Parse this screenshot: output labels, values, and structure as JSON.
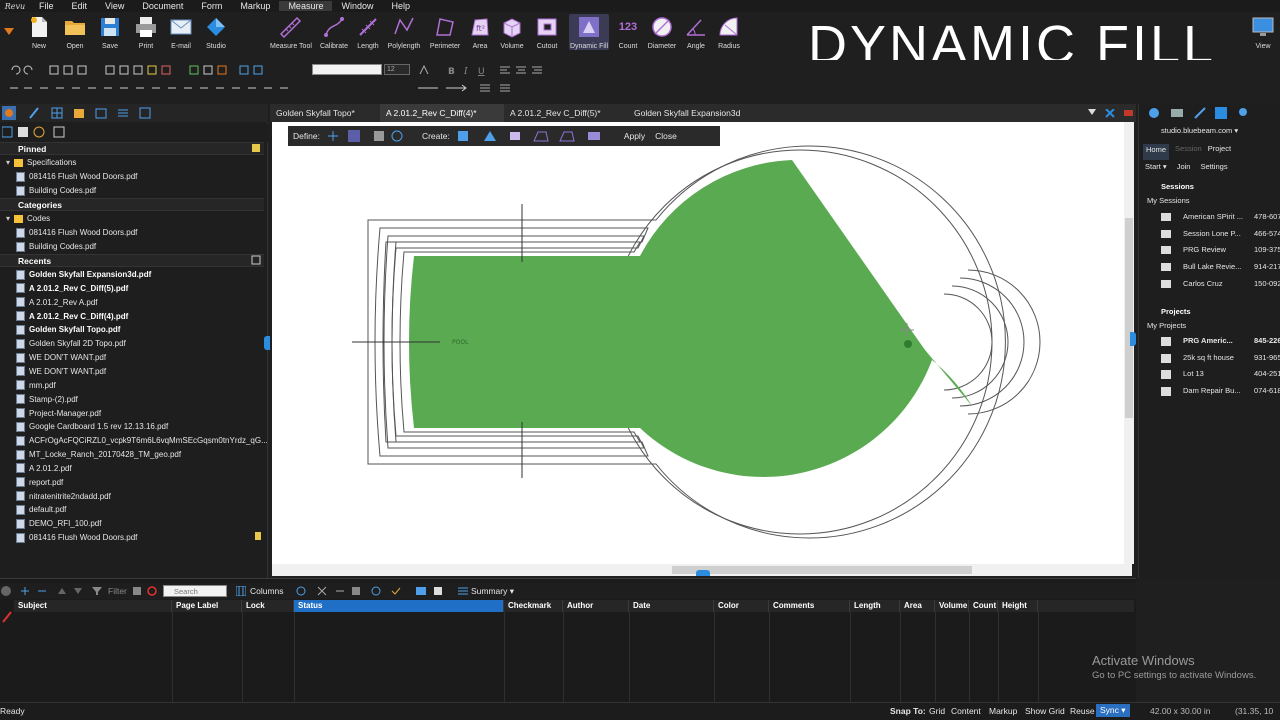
{
  "menu": [
    "File",
    "Edit",
    "View",
    "Document",
    "Form",
    "Markup",
    "Measure",
    "Window",
    "Help"
  ],
  "menu_active": "Measure",
  "app_logo": "Revu",
  "ribbon_left": [
    {
      "label": "New",
      "icon": "new-file-icon"
    },
    {
      "label": "Open",
      "icon": "folder-icon"
    },
    {
      "label": "Save",
      "icon": "save-icon"
    },
    {
      "label": "Print",
      "icon": "printer-icon"
    },
    {
      "label": "E-mail",
      "icon": "email-icon"
    },
    {
      "label": "Studio",
      "icon": "studio-icon"
    }
  ],
  "ribbon_measure": [
    {
      "label": "Measure Tool",
      "icon": "measure-tool-icon"
    },
    {
      "label": "Calibrate",
      "icon": "calibrate-icon"
    },
    {
      "label": "Length",
      "icon": "length-icon"
    },
    {
      "label": "Polylength",
      "icon": "polylength-icon"
    },
    {
      "label": "Perimeter",
      "icon": "perimeter-icon"
    },
    {
      "label": "Area",
      "icon": "area-icon"
    },
    {
      "label": "Volume",
      "icon": "volume-icon"
    },
    {
      "label": "Cutout",
      "icon": "cutout-icon"
    },
    {
      "label": "Dynamic Fill",
      "icon": "dynamic-fill-icon"
    },
    {
      "label": "Count",
      "icon": "count-icon"
    },
    {
      "label": "Diameter",
      "icon": "diameter-icon"
    },
    {
      "label": "Angle",
      "icon": "angle-icon"
    },
    {
      "label": "Radius",
      "icon": "radius-icon"
    }
  ],
  "count_glyph": "123",
  "ribbon_view": "View",
  "overlay_title": "DYNAMIC FILL",
  "font_size_value": "12",
  "left_tabs_icons": [
    "studio-icon",
    "pen-icon",
    "grid-icon",
    "stamp-icon",
    "layers-icon",
    "list-icon"
  ],
  "sections": {
    "pinned": {
      "title": "Pinned",
      "sub": "Specifications",
      "items": [
        "081416 Flush Wood Doors.pdf",
        "Building Codes.pdf"
      ]
    },
    "categories": {
      "title": "Categories",
      "sub": "Codes",
      "items": [
        "081416 Flush Wood Doors.pdf",
        "Building Codes.pdf"
      ]
    },
    "recents": {
      "title": "Recents",
      "items": [
        {
          "name": "Golden Skyfall Expansion3d.pdf",
          "bold": true
        },
        {
          "name": "A 2.01.2_Rev C_Diff(5).pdf",
          "bold": true
        },
        {
          "name": "A 2.01.2_Rev A.pdf",
          "bold": false
        },
        {
          "name": "A 2.01.2_Rev C_Diff(4).pdf",
          "bold": true
        },
        {
          "name": "Golden Skyfall Topo.pdf",
          "bold": true
        },
        {
          "name": "Golden Skyfall 2D Topo.pdf",
          "bold": false
        },
        {
          "name": "WE DON'T WANT.pdf",
          "bold": false
        },
        {
          "name": "WE DON'T WANT.pdf",
          "bold": false
        },
        {
          "name": "mm.pdf",
          "bold": false
        },
        {
          "name": "Stamp-(2).pdf",
          "bold": false
        },
        {
          "name": "Project-Manager.pdf",
          "bold": false
        },
        {
          "name": "Google Cardboard 1.5 rev 12.13.16.pdf",
          "bold": false
        },
        {
          "name": "ACFrOgAcFQCiRZL0_vcpk9T6m6L6vqMmSEcGqsm0tnYrdz_qG...",
          "bold": false
        },
        {
          "name": "MT_Locke_Ranch_20170428_TM_geo.pdf",
          "bold": false
        },
        {
          "name": "A 2.01.2.pdf",
          "bold": false
        },
        {
          "name": "report.pdf",
          "bold": false
        },
        {
          "name": "nitratenitrite2ndadd.pdf",
          "bold": false
        },
        {
          "name": "default.pdf",
          "bold": false
        },
        {
          "name": "DEMO_RFI_100.pdf",
          "bold": false
        },
        {
          "name": "081416 Flush Wood Doors.pdf",
          "bold": false
        }
      ]
    }
  },
  "doc_tabs": [
    {
      "label": "Golden Skyfall Topo*",
      "active": false
    },
    {
      "label": "A 2.01.2_Rev C_Diff(4)*",
      "active": true
    },
    {
      "label": "A 2.01.2_Rev C_Diff(5)*",
      "active": false
    },
    {
      "label": "Golden Skyfall Expansion3d",
      "active": false
    }
  ],
  "define_bar": {
    "define": "Define:",
    "create": "Create:",
    "apply": "Apply",
    "close": "Close"
  },
  "drawing": {
    "pool_label": "POOL",
    "fill_color": "#5aaa52"
  },
  "right_pane": {
    "server": "studio.bluebeam.com",
    "tabs": [
      "Home",
      "Session",
      "Project"
    ],
    "actions": [
      "Start",
      "Join",
      "Settings"
    ],
    "sessions_title": "Sessions",
    "my_sessions": "My Sessions",
    "sessions": [
      {
        "name": "American SPirit ...",
        "id": "478-607"
      },
      {
        "name": "Session Lone P...",
        "id": "466-574"
      },
      {
        "name": "PRG Review",
        "id": "109-375"
      },
      {
        "name": "Bull Lake Revie...",
        "id": "914-217"
      },
      {
        "name": "Carlos Cruz",
        "id": "150-092"
      }
    ],
    "projects_title": "Projects",
    "my_projects": "My Projects",
    "projects": [
      {
        "name": "PRG Americ...",
        "id": "845-226-",
        "bold": true
      },
      {
        "name": "25k sq ft house",
        "id": "931-965",
        "bold": false
      },
      {
        "name": "Lot 13",
        "id": "404-251",
        "bold": false
      },
      {
        "name": "Dam Repair Bu...",
        "id": "074-618",
        "bold": false
      }
    ]
  },
  "markups_toolbar": {
    "filter": "Filter",
    "search_placeholder": "Search",
    "columns": "Columns",
    "summary": "Summary"
  },
  "markups_columns": [
    "Subject",
    "Page Label",
    "Lock",
    "Status",
    "Checkmark",
    "Author",
    "Date",
    "Color",
    "Comments",
    "Length",
    "Area",
    "Volume",
    "Count",
    "Height"
  ],
  "selected_column": "Status",
  "watermark": {
    "line1": "Activate Windows",
    "line2": "Go to PC settings to activate Windows."
  },
  "status": {
    "left": "Ready",
    "snap_to": "Snap To:",
    "items": [
      "Grid",
      "Content",
      "Markup",
      "Show Grid",
      "Reuse"
    ],
    "sync": "Sync",
    "dimensions": "42.00 x 30.00 in",
    "coords": "(31.35, 10"
  }
}
